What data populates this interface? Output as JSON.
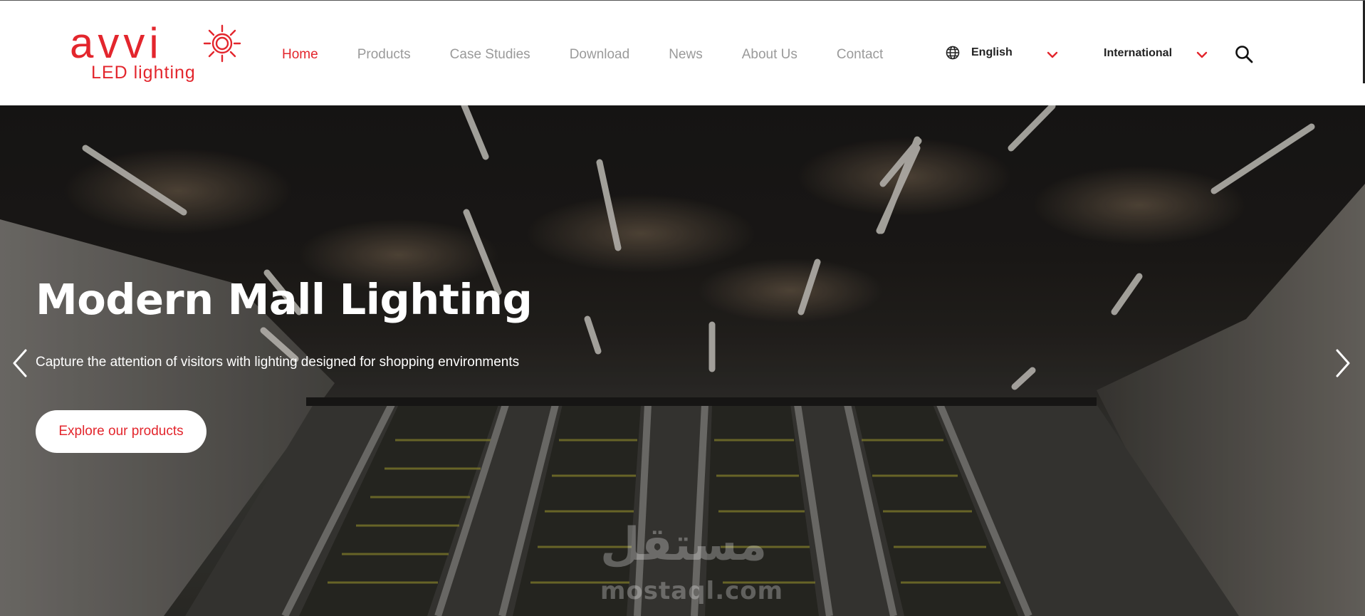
{
  "brand": {
    "logo_word": "avvi",
    "logo_sub": "LED lighting",
    "accent_color": "#e3262d"
  },
  "nav": {
    "items": [
      {
        "label": "Home",
        "active": true
      },
      {
        "label": "Products",
        "active": false
      },
      {
        "label": "Case Studies",
        "active": false
      },
      {
        "label": "Download",
        "active": false
      },
      {
        "label": "News",
        "active": false
      },
      {
        "label": "About Us",
        "active": false
      },
      {
        "label": "Contact",
        "active": false
      }
    ]
  },
  "language": {
    "selected": "English",
    "icon": "globe-icon"
  },
  "region": {
    "selected": "International"
  },
  "search": {
    "icon": "search-icon"
  },
  "hero": {
    "title": "Modern Mall Lighting",
    "subtitle": "Capture the attention of visitors with lighting designed for shopping environments",
    "cta_label": "Explore our products",
    "prev_icon": "chevron-left-icon",
    "next_icon": "chevron-right-icon"
  },
  "watermark": {
    "arabic": "مستقل",
    "latin": "mostaql.com"
  }
}
